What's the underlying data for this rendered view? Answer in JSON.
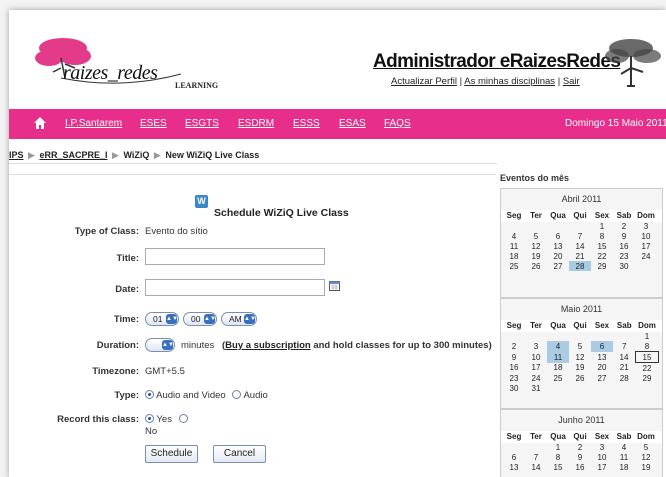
{
  "header": {
    "logo_text": "raizes_redes",
    "logo_sub": "LEARNING",
    "admin_title": "Administrador eRaizesRedes",
    "links": [
      "Actualizar Perfil",
      "As minhas disciplinas",
      "Sair"
    ],
    "separator": "|"
  },
  "nav": {
    "items": [
      "I.P.Santarem",
      "ESES",
      "ESGTS",
      "ESDRM",
      "ESSS",
      "ESAS",
      "FAQS"
    ],
    "date": "Domingo 15 Maio 2011",
    "color": "#e62e8a"
  },
  "breadcrumb": {
    "items": [
      "IPS",
      "eRR_SACPRE_I",
      "WiZiQ",
      "New WiZiQ Live Class"
    ],
    "separator": "▶"
  },
  "form": {
    "icon_letter": "W",
    "title": "Schedule WiZiQ Live Class",
    "type_label": "Type of Class:",
    "type_value": "Evento do sítio",
    "title_label": "Title:",
    "title_value": "",
    "date_label": "Date:",
    "date_value": "",
    "time_label": "Time:",
    "time_hour": "01",
    "time_min": "00",
    "time_ampm": "AM",
    "duration_label": "Duration:",
    "duration_value": "",
    "duration_unit": "minutes",
    "subscription_link": "Buy a subscription",
    "subscription_text": "and hold classes for up to 300 minutes)",
    "subscription_open": "(",
    "timezone_label": "Timezone:",
    "timezone_value": "GMT+5.5",
    "class_type_label": "Type:",
    "class_type_options": [
      "Audio and Video",
      "Audio"
    ],
    "record_label": "Record this class:",
    "record_options": [
      "Yes",
      "No"
    ],
    "schedule_button": "Schedule",
    "cancel_button": "Cancel"
  },
  "sidebar": {
    "title": "Eventos do mês",
    "weekdays": [
      "Seg",
      "Ter",
      "Qua",
      "Qui",
      "Sex",
      "Sab",
      "Dom"
    ],
    "calendars": [
      {
        "month": "Abril 2011",
        "weeks": [
          [
            "",
            "",
            "",
            "",
            "1",
            "2",
            "3"
          ],
          [
            "4",
            "5",
            "6",
            "7",
            "8",
            "9",
            "10"
          ],
          [
            "11",
            "12",
            "13",
            "14",
            "15",
            "16",
            "17"
          ],
          [
            "18",
            "19",
            "20",
            "21",
            "22",
            "23",
            "24"
          ],
          [
            "25",
            "26",
            "27",
            "28",
            "29",
            "30",
            ""
          ]
        ],
        "highlighted": [
          "28"
        ]
      },
      {
        "month": "Maio 2011",
        "weeks": [
          [
            "",
            "",
            "",
            "",
            "",
            "",
            "1"
          ],
          [
            "2",
            "3",
            "4",
            "5",
            "6",
            "7",
            "8"
          ],
          [
            "9",
            "10",
            "11",
            "12",
            "13",
            "14",
            "15"
          ],
          [
            "16",
            "17",
            "18",
            "19",
            "20",
            "21",
            "22"
          ],
          [
            "23",
            "24",
            "25",
            "26",
            "27",
            "28",
            "29"
          ],
          [
            "30",
            "31",
            "",
            "",
            "",
            "",
            ""
          ]
        ],
        "highlighted": [
          "4",
          "6",
          "11"
        ],
        "today": "15"
      },
      {
        "month": "Junho 2011",
        "weeks": [
          [
            "",
            "",
            "1",
            "2",
            "3",
            "4",
            "5"
          ],
          [
            "6",
            "7",
            "8",
            "9",
            "10",
            "11",
            "12"
          ],
          [
            "13",
            "14",
            "15",
            "16",
            "17",
            "18",
            "19"
          ]
        ],
        "highlighted": []
      }
    ]
  }
}
